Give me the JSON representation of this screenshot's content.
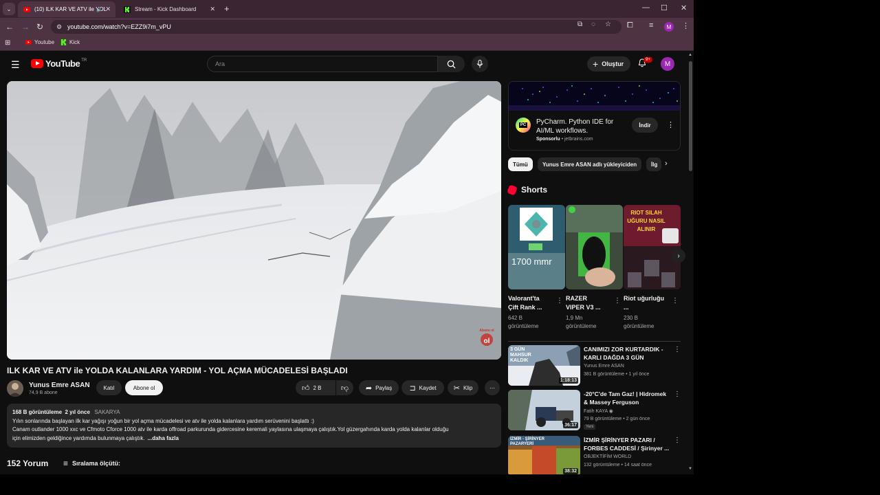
{
  "browser": {
    "tabs": [
      {
        "title": "(10) ILK KAR VE ATV ile YOL",
        "active": true
      },
      {
        "title": "Stream - Kick Dashboard",
        "active": false
      }
    ],
    "url": "youtube.com/watch?v=EZZ9i7m_vPU",
    "profile_initial": "M",
    "bookmarks": [
      {
        "label": "Youtube"
      },
      {
        "label": "Kick"
      }
    ]
  },
  "youtube": {
    "logo_text": "YouTube",
    "country_code": "TR",
    "search_placeholder": "Ara",
    "create_label": "Oluştur",
    "notif_badge": "9+",
    "avatar_initial": "M"
  },
  "video": {
    "title": "ILK KAR VE ATV ile YOLDA KALANLARA YARDIM - YOL AÇMA MÜCADELESİ BAŞLADI",
    "watermark": "Abone ol",
    "channel": "Yunus Emre ASAN",
    "subscribers": "74,9 B abone",
    "join_label": "Katıl",
    "subscribe_label": "Abone ol",
    "likes": "2 B",
    "share_label": "Paylaş",
    "save_label": "Kaydet",
    "clip_label": "Klip",
    "views": "168 B görüntüleme",
    "age": "2 yıl önce",
    "location": "SAKARYA",
    "desc_line1": "Yılın sonlarında başlayan ilk kar yağışı yoğun bir yol açma mücadelesi ve atv ile yolda kalanlara yardım serüvenini başlattı :)",
    "desc_line2": "Canam outlander 1000 xxc ve Cfmoto Cforce 1000 atv ile karda offroad parkurunda gidercesine keremali yaylasına ulaşmaya çalıştık.Yol güzergahında karda yolda kalanlar olduğu",
    "desc_line3": "için elimizden geldiğince yardımda bulunmaya çalıştık.",
    "more_label": "...daha fazla",
    "comments_count": "152 Yorum",
    "sort_label": "Sıralama ölçütü:"
  },
  "ad": {
    "title": "PyCharm. Python IDE for AI/ML workflows.",
    "sponsored": "Sponsorlu",
    "domain": "jetbrains.com",
    "button": "İndir",
    "logo_text": "PC"
  },
  "chips": [
    "Tümü",
    "Yunus Emre ASAN adlı yükleyiciden",
    "İlg"
  ],
  "shorts_title": "Shorts",
  "shorts": [
    {
      "title": "Valorant'ta Çift Rank ...",
      "views": "642 B görüntüleme",
      "overlay": "1700 mmr"
    },
    {
      "title": "RAZER VIPER V3 ...",
      "views": "1,9 Mn görüntüleme"
    },
    {
      "title": "Riot uğurluğu ...",
      "views": "230 B görüntüleme",
      "overlay": "RIOT SILAH UĞURU NASIL ALINIR"
    }
  ],
  "recommendations": [
    {
      "title": "CANIMIZI ZOR KURTARDIK - KARLI DAĞDA 3 GÜN MAHSU...",
      "channel": "Yunus Emre ASAN",
      "meta": "381 B görüntüleme • 1 yıl önce",
      "duration": "1:18:13",
      "thumb_text": "3 GÜN MAHSUR KALDIK"
    },
    {
      "title": "-20°C'de Tam Gaz! | Hidromek & Massey Ferguson",
      "channel": "Fatih KAYA",
      "meta": "79 B görüntüleme • 2 gün önce",
      "duration": "36:17",
      "badge": "Yeni"
    },
    {
      "title": "İZMİR ŞİRİNYER PAZARI / FORBES CADDESİ / Şirinyer ...",
      "channel": "OBJEKTİFİM WORLD",
      "meta": "132 görüntüleme • 14 saat önce",
      "duration": "38:32",
      "thumb_text": "İZMİR - ŞİRİNYER PAZARYERİ"
    }
  ],
  "colors": {
    "brand_red": "#ff0000",
    "bg": "#0f0f0f",
    "chrome": "#4e3342",
    "accent_purple": "#9c27b0"
  }
}
